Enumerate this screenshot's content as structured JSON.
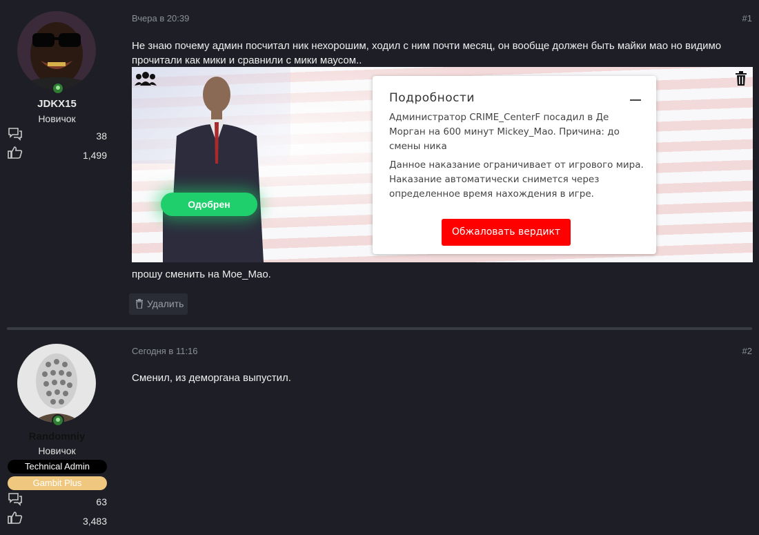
{
  "posts": [
    {
      "username": "JDKX15",
      "role": "Новичок",
      "messages_count": "38",
      "reactions_count": "1,499",
      "date": "Вчера в 20:39",
      "number": "#1",
      "text": "Не знаю почему админ посчитал ник нехорошим, ходил с ним почти месяц, он вообще должен быть майки мао но видимо прочитали как мики и сравнили с мики маусом..",
      "screenshot": {
        "status_label": "Одобрен",
        "card_title": "Подробности",
        "card_line1": "Администратор CRIME_CenterF посадил в Де Морган на 600 минут Mickey_Mao. Причина: до смены ника",
        "card_line2": "Данное наказание ограничивает от игрового мира. Наказание автоматически снимется через определенное время нахождения в игре.",
        "appeal_button": "Обжаловать вердикт"
      },
      "footer_text": "прошу сменить на Moe_Mao.",
      "delete_label": "Удалить"
    },
    {
      "username": "Randomniy",
      "role": "Новичок",
      "banner_tech": "Technical Admin",
      "banner_gambit": "Gambit Plus",
      "messages_count": "63",
      "reactions_count": "3,483",
      "date": "Сегодня в 11:16",
      "number": "#2",
      "text": "Сменил, из деморгана выпустил."
    }
  ],
  "colors": {
    "background": "#1e1f26",
    "approved_green": "#1fcf6b",
    "appeal_red": "#ff0000",
    "gambit_gold": "#f0c77e",
    "online_green": "#2f7d32"
  },
  "icons": [
    "messages-icon",
    "like-icon",
    "group-icon",
    "trash-icon",
    "minimize-icon",
    "online-status-icon"
  ]
}
